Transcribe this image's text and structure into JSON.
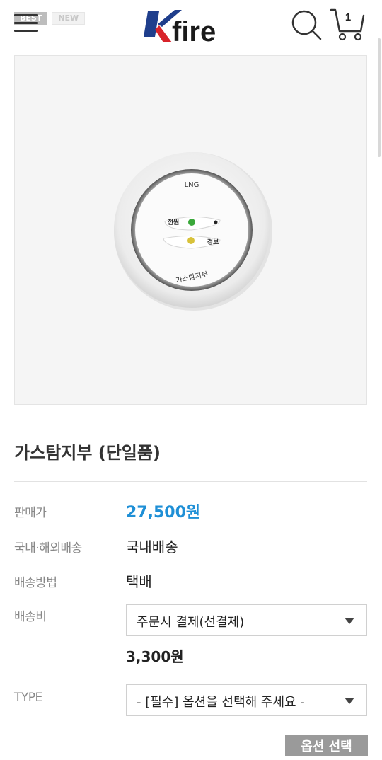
{
  "header": {
    "badges": [
      "BEST",
      "NEW"
    ],
    "logo_icon": "kfire-logo",
    "logo_text": "fire",
    "menu_icon": "hamburger-menu-icon",
    "search_icon": "search-icon",
    "cart_icon": "cart-icon",
    "cart_count": "1"
  },
  "product": {
    "image_labels": {
      "top": "LNG",
      "power": "전원",
      "alarm": "경보",
      "bottom": "가스탐지부"
    },
    "title": "가스탐지부 (단일품)",
    "rows": {
      "price_label": "판매가",
      "price_value": "27,500원",
      "shipping_region_label": "국내·해외배송",
      "shipping_region_value": "국내배송",
      "shipping_method_label": "배송방법",
      "shipping_method_value": "택배",
      "shipping_fee_label": "배송비",
      "shipping_fee_select": "주문시 결제(선결제)",
      "shipping_fee_value": "3,300원",
      "type_label": "TYPE",
      "type_select": "- [필수] 옵션을 선택해 주세요 -"
    },
    "option_button": "옵션 선택"
  },
  "colors": {
    "price": "#1e8fd6",
    "logo_blue": "#1f3e8c",
    "logo_red": "#d8232a"
  }
}
